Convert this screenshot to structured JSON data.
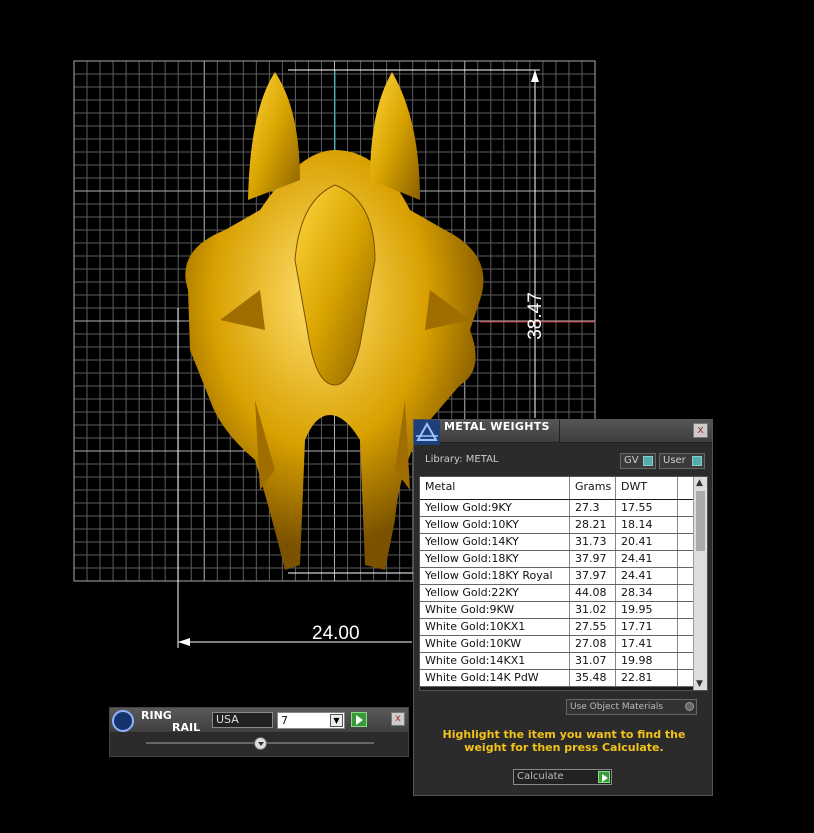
{
  "viewport": {
    "width_dimension": "24.00",
    "height_dimension": "38.47"
  },
  "metal_weights": {
    "title": "METAL WEIGHTS",
    "close_label": "x",
    "library_label": "Library: METAL",
    "toggle_gv": "GV",
    "toggle_user": "User",
    "columns": [
      "Metal",
      "Grams",
      "DWT"
    ],
    "rows": [
      {
        "metal": "Yellow Gold:9KY",
        "grams": "27.3",
        "dwt": "17.55"
      },
      {
        "metal": "Yellow Gold:10KY",
        "grams": "28.21",
        "dwt": "18.14"
      },
      {
        "metal": "Yellow Gold:14KY",
        "grams": "31.73",
        "dwt": "20.41"
      },
      {
        "metal": "Yellow Gold:18KY",
        "grams": "37.97",
        "dwt": "24.41"
      },
      {
        "metal": "Yellow Gold:18KY Royal",
        "grams": "37.97",
        "dwt": "24.41"
      },
      {
        "metal": "Yellow Gold:22KY",
        "grams": "44.08",
        "dwt": "28.34"
      },
      {
        "metal": "White Gold:9KW",
        "grams": "31.02",
        "dwt": "19.95"
      },
      {
        "metal": "White Gold:10KX1",
        "grams": "27.55",
        "dwt": "17.71"
      },
      {
        "metal": "White Gold:10KW",
        "grams": "27.08",
        "dwt": "17.41"
      },
      {
        "metal": "White Gold:14KX1",
        "grams": "31.07",
        "dwt": "19.98"
      },
      {
        "metal": "White Gold:14K PdW",
        "grams": "35.48",
        "dwt": "22.81"
      }
    ],
    "use_object_materials": "Use Object Materials",
    "hint": "Highlight the item you want to find the weight for then press Calculate.",
    "calculate_label": "Calculate"
  },
  "ring_rail": {
    "title_line1": "RING",
    "title_line2": "RAIL",
    "country": "USA",
    "size": "7",
    "close_label": "x"
  },
  "colors": {
    "gold": "#d9a400",
    "hint_yellow": "#f3c21a",
    "grid": "#8a8a8a"
  }
}
